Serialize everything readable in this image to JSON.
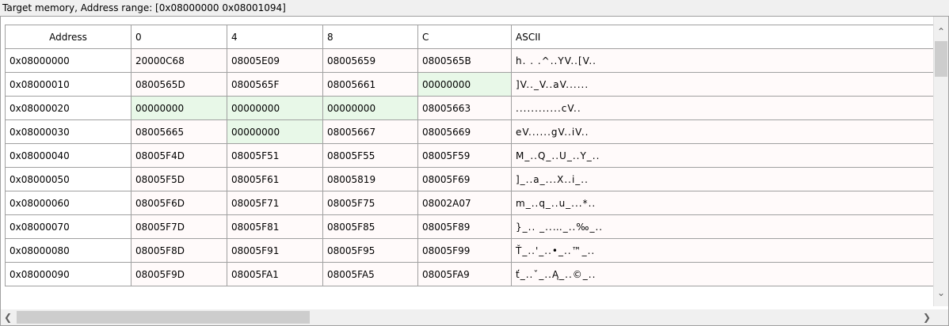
{
  "window": {
    "title": "Target memory, Address range: [0x08000000 0x08001094]"
  },
  "columns": [
    "Address",
    "0",
    "4",
    "8",
    "C",
    "ASCII"
  ],
  "rows": [
    {
      "address": "0x08000000",
      "c0": "20000C68",
      "c4": "08005E09",
      "c8": "08005659",
      "cC": "0800565B",
      "ascii": "h. . .^..YV..[V.."
    },
    {
      "address": "0x08000010",
      "c0": "0800565D",
      "c4": "0800565F",
      "c8": "08005661",
      "cC": "00000000",
      "ascii": "]V.._V..aV......"
    },
    {
      "address": "0x08000020",
      "c0": "00000000",
      "c4": "00000000",
      "c8": "00000000",
      "cC": "08005663",
      "ascii": "............cV.."
    },
    {
      "address": "0x08000030",
      "c0": "08005665",
      "c4": "00000000",
      "c8": "08005667",
      "cC": "08005669",
      "ascii": "eV......gV..iV.."
    },
    {
      "address": "0x08000040",
      "c0": "08005F4D",
      "c4": "08005F51",
      "c8": "08005F55",
      "cC": "08005F59",
      "ascii": "M_..Q_..U_..Y_.."
    },
    {
      "address": "0x08000050",
      "c0": "08005F5D",
      "c4": "08005F61",
      "c8": "08005819",
      "cC": "08005F69",
      "ascii": "]_..a_...X..i_.."
    },
    {
      "address": "0x08000060",
      "c0": "08005F6D",
      "c4": "08005F71",
      "c8": "08005F75",
      "cC": "08002A07",
      "ascii": "m_..q_..u_...*.."
    },
    {
      "address": "0x08000070",
      "c0": "08005F7D",
      "c4": "08005F81",
      "c8": "08005F85",
      "cC": "08005F89",
      "ascii": "}_.. _..…_..‰_.."
    },
    {
      "address": "0x08000080",
      "c0": "08005F8D",
      "c4": "08005F91",
      "c8": "08005F95",
      "cC": "08005F99",
      "ascii": "Ť_..'_..•_..™_.."
    },
    {
      "address": "0x08000090",
      "c0": "08005F9D",
      "c4": "08005FA1",
      "c8": "08005FA5",
      "cC": "08005FA9",
      "ascii": "ť_..ˇ_..Ą_..©_.."
    }
  ],
  "colors": {
    "zero_highlight": "#e8f8e8",
    "cell_background": "#fffafa",
    "grid_line": "#a0a0a0"
  },
  "icons": {
    "scroll_up": "chevron-up-icon",
    "scroll_left": "chevron-left-icon",
    "scroll_right": "chevron-right-icon",
    "scroll_down": "chevron-down-icon"
  }
}
